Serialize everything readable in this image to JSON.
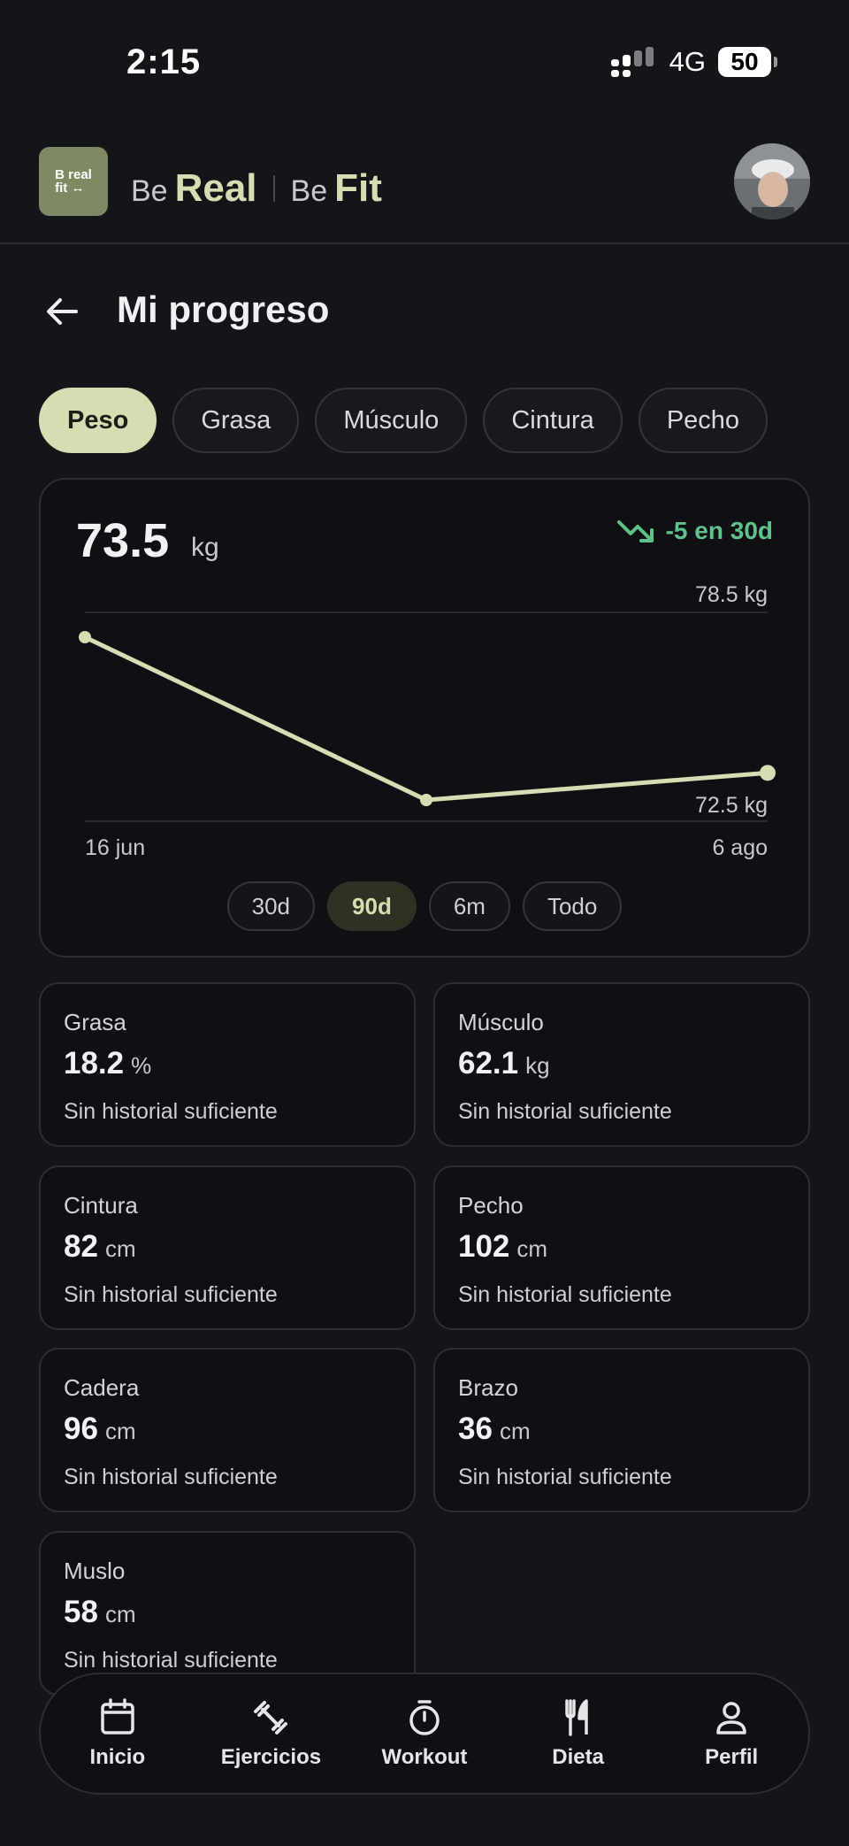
{
  "status_bar": {
    "time": "2:15",
    "network": "4G",
    "battery": "50"
  },
  "header": {
    "logo_line1": "B real",
    "logo_line2": "fit ↔",
    "brand": {
      "be1": "Be",
      "word1": "Real",
      "be2": "Be",
      "word2": "Fit"
    }
  },
  "page": {
    "title": "Mi progreso"
  },
  "tabs": [
    {
      "label": "Peso",
      "active": true
    },
    {
      "label": "Grasa",
      "active": false
    },
    {
      "label": "Músculo",
      "active": false
    },
    {
      "label": "Cintura",
      "active": false
    },
    {
      "label": "Pecho",
      "active": false
    }
  ],
  "chart": {
    "current_value": "73.5",
    "current_unit": "kg",
    "trend_label": "-5 en 30d",
    "y_max_label": "78.5 kg",
    "y_min_label": "72.5 kg",
    "x_start_label": "16 jun",
    "x_end_label": "6 ago",
    "ranges": [
      {
        "label": "30d",
        "active": false
      },
      {
        "label": "90d",
        "active": true
      },
      {
        "label": "6m",
        "active": false
      },
      {
        "label": "Todo",
        "active": false
      }
    ]
  },
  "chart_data": {
    "type": "line",
    "x": [
      "16 jun",
      "16 jul",
      "6 ago"
    ],
    "series": [
      {
        "values": [
          78.5,
          72.5,
          73.5
        ]
      }
    ],
    "ylim": [
      72.5,
      78.5
    ],
    "xlabel": "",
    "ylabel": "",
    "grid": true,
    "color": "#d6ddb2"
  },
  "stats": [
    {
      "label": "Grasa",
      "value": "18.2",
      "unit": "%",
      "note": "Sin historial suficiente"
    },
    {
      "label": "Músculo",
      "value": "62.1",
      "unit": "kg",
      "note": "Sin historial suficiente"
    },
    {
      "label": "Cintura",
      "value": "82",
      "unit": "cm",
      "note": "Sin historial suficiente"
    },
    {
      "label": "Pecho",
      "value": "102",
      "unit": "cm",
      "note": "Sin historial suficiente"
    },
    {
      "label": "Cadera",
      "value": "96",
      "unit": "cm",
      "note": "Sin historial suficiente"
    },
    {
      "label": "Brazo",
      "value": "36",
      "unit": "cm",
      "note": "Sin historial suficiente"
    },
    {
      "label": "Muslo",
      "value": "58",
      "unit": "cm",
      "note": "Sin historial suficiente"
    }
  ],
  "nav": [
    {
      "label": "Inicio",
      "icon": "calendar-icon"
    },
    {
      "label": "Ejercicios",
      "icon": "dumbbell-icon"
    },
    {
      "label": "Workout",
      "icon": "stopwatch-icon"
    },
    {
      "label": "Dieta",
      "icon": "fork-knife-icon"
    },
    {
      "label": "Perfil",
      "icon": "user-icon"
    }
  ]
}
